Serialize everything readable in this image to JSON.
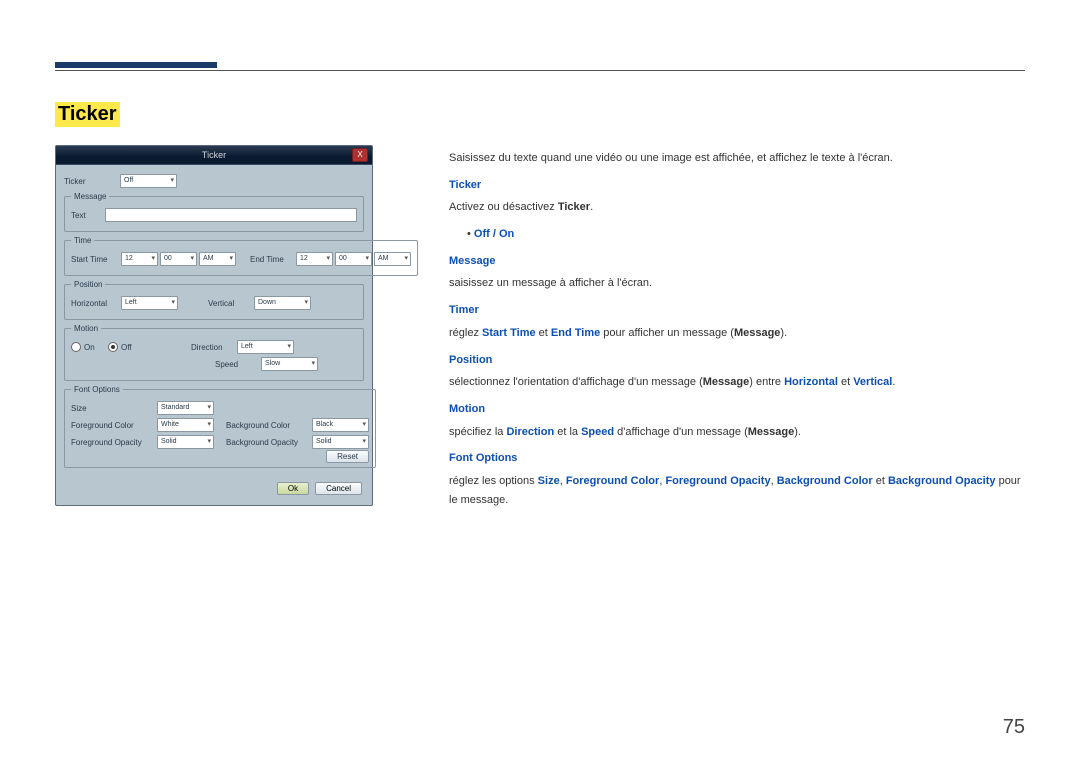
{
  "page_number": "75",
  "title": "Ticker",
  "intro": "Saisissez du texte quand une vidéo ou une image est affichée, et affichez le texte à l'écran.",
  "sections": {
    "ticker_label": "Ticker",
    "ticker_text_pre": "Activez ou désactivez ",
    "ticker_text_bold": "Ticker",
    "off_on": "Off / On",
    "message_label": "Message",
    "message_text": "saisissez un message à afficher à l'écran.",
    "timer_label": "Timer",
    "timer_pre": "réglez ",
    "timer_start": "Start Time",
    "timer_mid": " et ",
    "timer_end": "End Time",
    "timer_post": " pour afficher un message (",
    "timer_msg": "Message",
    "timer_close": ").",
    "position_label": "Position",
    "pos_pre": "sélectionnez l'orientation d'affichage d'un message (",
    "pos_msg": "Message",
    "pos_mid": ") entre ",
    "pos_horiz": "Horizontal",
    "pos_and": " et ",
    "pos_vert": "Vertical",
    "motion_label": "Motion",
    "mot_pre": "spécifiez la ",
    "mot_dir": "Direction",
    "mot_mid": " et la ",
    "mot_speed": "Speed",
    "mot_post": " d'affichage d'un message (",
    "mot_msg": "Message",
    "mot_close": ").",
    "font_label": "Font Options",
    "font_pre": "réglez les options ",
    "font_size": "Size",
    "font_c1": ", ",
    "font_fgc": "Foreground Color",
    "font_c2": ", ",
    "font_fgo": "Foreground Opacity",
    "font_c3": ", ",
    "font_bgc": "Background Color",
    "font_c4": " et ",
    "font_bgo": "Background Opacity",
    "font_post": " pour le message."
  },
  "dialog": {
    "title": "Ticker",
    "close": "X",
    "labels": {
      "ticker": "Ticker",
      "message": "Message",
      "text": "Text",
      "time": "Time",
      "start_time": "Start Time",
      "end_time": "End Time",
      "position": "Position",
      "horizontal": "Horizontal",
      "vertical": "Vertical",
      "motion": "Motion",
      "on": "On",
      "off": "Off",
      "direction": "Direction",
      "speed": "Speed",
      "font_options": "Font Options",
      "size": "Size",
      "fg_color": "Foreground Color",
      "fg_opacity": "Foreground Opacity",
      "bg_color": "Background Color",
      "bg_opacity": "Background Opacity",
      "reset": "Reset",
      "ok": "Ok",
      "cancel": "Cancel"
    },
    "values": {
      "ticker": "Off",
      "st_h": "12",
      "st_m": "00",
      "st_ap": "AM",
      "et_h": "12",
      "et_m": "00",
      "et_ap": "AM",
      "h_pos": "Left",
      "v_pos": "Down",
      "direction": "Left",
      "speed": "Slow",
      "size": "Standard",
      "fg_color": "White",
      "fg_opacity": "Solid",
      "bg_color": "Black",
      "bg_opacity": "Solid"
    }
  }
}
